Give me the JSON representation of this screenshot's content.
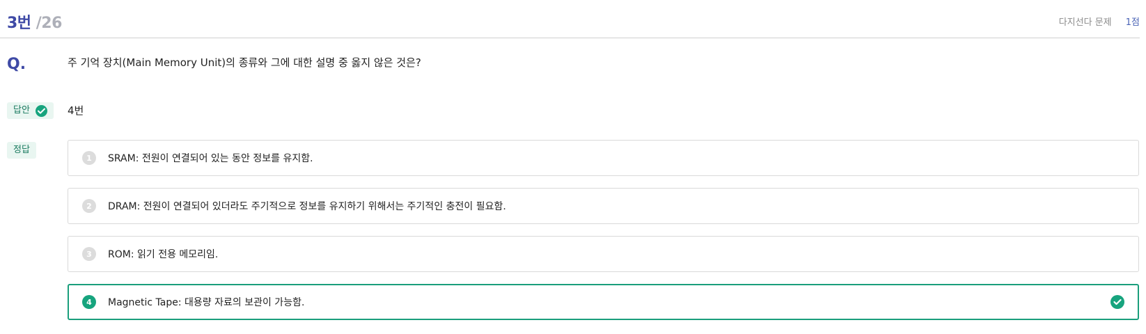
{
  "header": {
    "question_number": "3번",
    "total": "/26",
    "question_type": "다지선다 문제",
    "points": "1점"
  },
  "question": {
    "marker": "Q.",
    "text": "주 기억 장치(Main Memory Unit)의 종류와 그에 대한 설명 중 옳지 않은 것은?"
  },
  "answer": {
    "tag_label": "답안",
    "value": "4번"
  },
  "correct": {
    "tag_label": "정답"
  },
  "options": [
    {
      "number": "1",
      "text": "SRAM: 전원이 연결되어 있는 동안 정보를 유지함."
    },
    {
      "number": "2",
      "text": "DRAM: 전원이 연결되어 있더라도 주기적으로 정보를 유지하기 위해서는 주기적인 충전이 필요함."
    },
    {
      "number": "3",
      "text": "ROM: 읽기 전용 메모리임."
    },
    {
      "number": "4",
      "text": "Magnetic Tape: 대용량 자료의 보관이 가능함."
    }
  ],
  "selected_option": 4,
  "colors": {
    "accent": "#3f4aa6",
    "correct": "#17a47e"
  }
}
